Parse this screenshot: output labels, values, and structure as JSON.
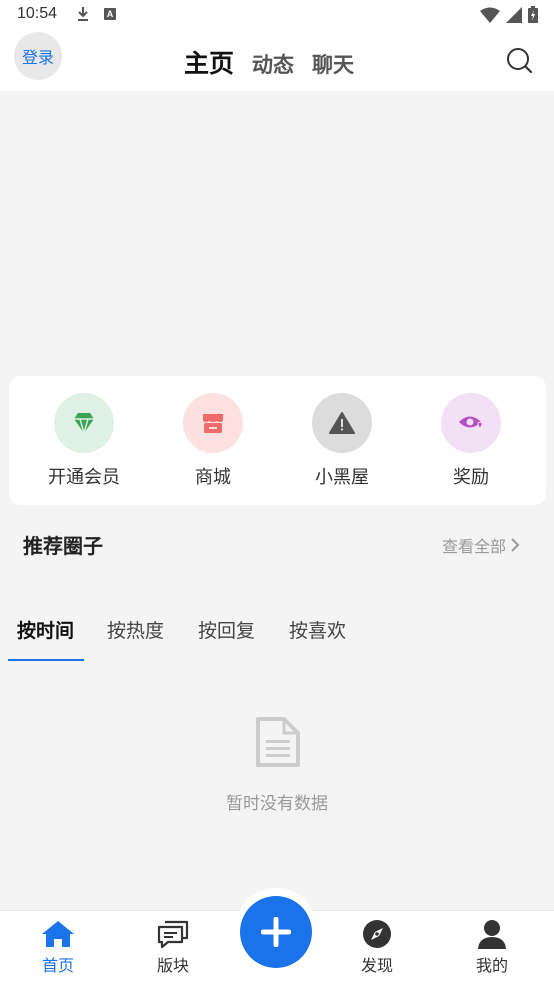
{
  "status_bar": {
    "time": "10:54",
    "icons": [
      "download-icon",
      "a-notification-icon",
      "wifi-icon",
      "signal-icon",
      "battery-icon"
    ]
  },
  "header": {
    "login_label": "登录",
    "tabs": [
      {
        "label": "主页",
        "active": true
      },
      {
        "label": "动态",
        "active": false
      },
      {
        "label": "聊天",
        "active": false
      }
    ],
    "search_icon": "search-icon"
  },
  "shortcuts": [
    {
      "label": "开通会员",
      "icon": "diamond-icon",
      "bg": "#dff0e4",
      "color": "#3aa557"
    },
    {
      "label": "商城",
      "icon": "shop-icon",
      "bg": "#fde1e1",
      "color": "#f06a6a"
    },
    {
      "label": "小黑屋",
      "icon": "warning-icon",
      "bg": "#dcdcdc",
      "color": "#555555"
    },
    {
      "label": "奖励",
      "icon": "eye-heart-icon",
      "bg": "#f2e1f4",
      "color": "#b34ec4"
    }
  ],
  "recommend": {
    "title": "推荐圈子",
    "view_all": "查看全部"
  },
  "sort_tabs": [
    {
      "label": "按时间",
      "active": true
    },
    {
      "label": "按热度",
      "active": false
    },
    {
      "label": "按回复",
      "active": false
    },
    {
      "label": "按喜欢",
      "active": false
    }
  ],
  "empty_state": {
    "icon": "document-icon",
    "text": "暂时没有数据"
  },
  "bottom_nav": [
    {
      "label": "首页",
      "icon": "home-icon",
      "active": true
    },
    {
      "label": "版块",
      "icon": "chat-bubbles-icon",
      "active": false
    },
    {
      "label": "发现",
      "icon": "compass-icon",
      "active": false
    },
    {
      "label": "我的",
      "icon": "person-icon",
      "active": false
    }
  ],
  "fab_icon": "plus-icon",
  "colors": {
    "accent": "#1a73e8",
    "background": "#f4f4f4"
  }
}
